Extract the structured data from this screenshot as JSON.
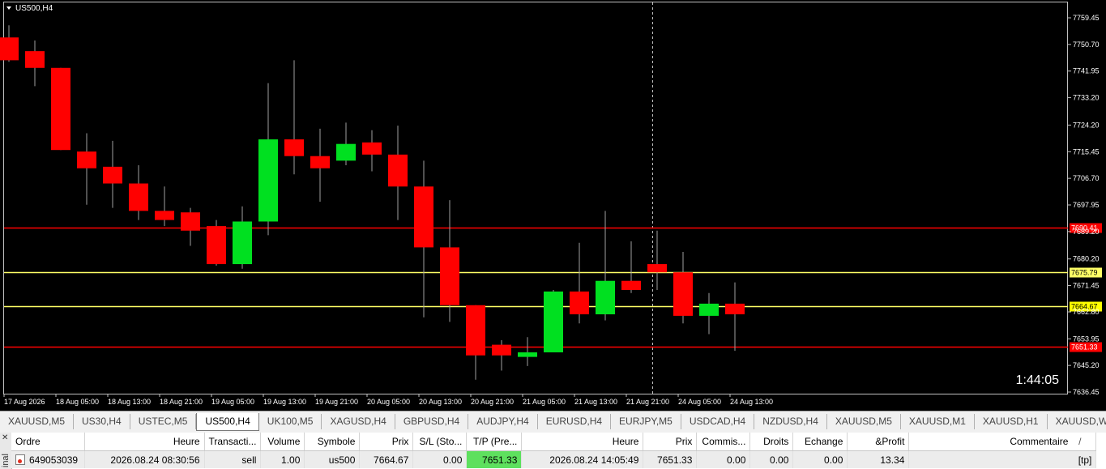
{
  "chart": {
    "symbol_label": "US500,H4",
    "countdown": "1:44:05",
    "colors": {
      "background": "#000000",
      "bull": "#00e020",
      "bear": "#ff0000",
      "wick": "#a0a0a0",
      "sl_line": "#ff0000",
      "price_line": "#ffff66"
    },
    "y_axis_ticks": [
      "7759.45",
      "7750.70",
      "7741.95",
      "7733.20",
      "7724.20",
      "7715.45",
      "7706.70",
      "7697.95",
      "7689.20",
      "7680.20",
      "7671.45",
      "7662.80",
      "7653.95",
      "7645.20",
      "7636.45"
    ],
    "y_range": [
      7636.45,
      7759.45
    ],
    "x_axis_ticks": [
      "17 Aug 2026",
      "18 Aug 05:00",
      "18 Aug 13:00",
      "18 Aug 21:00",
      "19 Aug 05:00",
      "19 Aug 13:00",
      "19 Aug 21:00",
      "20 Aug 05:00",
      "20 Aug 13:00",
      "20 Aug 21:00",
      "21 Aug 05:00",
      "21 Aug 13:00",
      "21 Aug 21:00",
      "24 Aug 05:00",
      "24 Aug 13:00"
    ],
    "levels": [
      {
        "label": "7690.41",
        "value": 7690.41,
        "kind": "sl"
      },
      {
        "label": "7675.79",
        "value": 7675.79,
        "kind": "entry"
      },
      {
        "label": "7664.67",
        "value": 7664.67,
        "kind": "current"
      },
      {
        "label": "7651.33",
        "value": 7651.33,
        "kind": "tp"
      }
    ],
    "candles": [
      {
        "o": 7753.0,
        "h": 7757.0,
        "l": 7745.0,
        "c": 7745.5
      },
      {
        "o": 7748.5,
        "h": 7752.0,
        "l": 7737.0,
        "c": 7743.0
      },
      {
        "o": 7743.0,
        "h": 7743.0,
        "l": 7716.0,
        "c": 7716.0
      },
      {
        "o": 7715.5,
        "h": 7721.5,
        "l": 7698.0,
        "c": 7710.0
      },
      {
        "o": 7710.5,
        "h": 7719.0,
        "l": 7697.0,
        "c": 7705.0
      },
      {
        "o": 7705.0,
        "h": 7711.0,
        "l": 7693.0,
        "c": 7696.0
      },
      {
        "o": 7696.0,
        "h": 7704.0,
        "l": 7691.0,
        "c": 7693.0
      },
      {
        "o": 7695.5,
        "h": 7697.0,
        "l": 7684.5,
        "c": 7689.5
      },
      {
        "o": 7691.0,
        "h": 7693.0,
        "l": 7678.0,
        "c": 7678.5
      },
      {
        "o": 7678.5,
        "h": 7697.5,
        "l": 7677.0,
        "c": 7692.5
      },
      {
        "o": 7692.5,
        "h": 7738.0,
        "l": 7688.0,
        "c": 7719.5
      },
      {
        "o": 7719.5,
        "h": 7745.5,
        "l": 7708.0,
        "c": 7714.0
      },
      {
        "o": 7714.0,
        "h": 7723.0,
        "l": 7699.0,
        "c": 7710.0
      },
      {
        "o": 7712.5,
        "h": 7725.0,
        "l": 7711.0,
        "c": 7718.0
      },
      {
        "o": 7718.5,
        "h": 7722.5,
        "l": 7709.0,
        "c": 7714.5
      },
      {
        "o": 7714.5,
        "h": 7724.0,
        "l": 7693.0,
        "c": 7704.0
      },
      {
        "o": 7704.0,
        "h": 7712.5,
        "l": 7661.0,
        "c": 7684.0
      },
      {
        "o": 7684.0,
        "h": 7699.5,
        "l": 7659.5,
        "c": 7665.0
      },
      {
        "o": 7665.0,
        "h": 7665.0,
        "l": 7640.5,
        "c": 7648.5
      },
      {
        "o": 7652.0,
        "h": 7653.5,
        "l": 7643.5,
        "c": 7648.5
      },
      {
        "o": 7648.0,
        "h": 7654.5,
        "l": 7645.0,
        "c": 7649.5
      },
      {
        "o": 7649.5,
        "h": 7670.0,
        "l": 7649.5,
        "c": 7669.5
      },
      {
        "o": 7669.5,
        "h": 7685.5,
        "l": 7659.0,
        "c": 7662.0
      },
      {
        "o": 7662.0,
        "h": 7696.0,
        "l": 7660.0,
        "c": 7673.0
      },
      {
        "o": 7673.0,
        "h": 7686.0,
        "l": 7669.0,
        "c": 7670.0
      },
      {
        "o": 7678.5,
        "h": 7689.5,
        "l": 7670.0,
        "c": 7675.8
      },
      {
        "o": 7675.8,
        "h": 7682.5,
        "l": 7659.0,
        "c": 7661.5
      },
      {
        "o": 7661.5,
        "h": 7669.0,
        "l": 7655.5,
        "c": 7665.5
      },
      {
        "o": 7665.5,
        "h": 7672.5,
        "l": 7650.0,
        "c": 7662.0
      }
    ]
  },
  "tabs": [
    "XAUUSD,M5",
    "US30,H4",
    "USTEC,M5",
    "US500,H4",
    "UK100,M5",
    "XAGUSD,H4",
    "GBPUSD,H4",
    "AUDJPY,H4",
    "EURUSD,H4",
    "EURJPY,M5",
    "USDCAD,H4",
    "NZDUSD,H4",
    "XAUUSD,M5",
    "XAUUSD,M1",
    "XAUUSD,H1",
    "XAUUSD,Weekl"
  ],
  "active_tab": 3,
  "terminal": {
    "side_label": "inal",
    "columns": [
      "Ordre",
      "Heure",
      "Transacti...",
      "Volume",
      "Symbole",
      "Prix",
      "S/L (Sto...",
      "T/P (Pre...",
      "Heure",
      "Prix",
      "Commis...",
      "Droits",
      "Echange",
      "&Profit",
      "Commentaire"
    ],
    "sort_indicator": "/",
    "rows": [
      [
        "649053039",
        "2026.08.24 08:30:56",
        "sell",
        "1.00",
        "us500",
        "7664.67",
        "0.00",
        "7651.33",
        "2026.08.24 14:05:49",
        "7651.33",
        "0.00",
        "0.00",
        "0.00",
        "13.34",
        "[tp]"
      ]
    ]
  }
}
